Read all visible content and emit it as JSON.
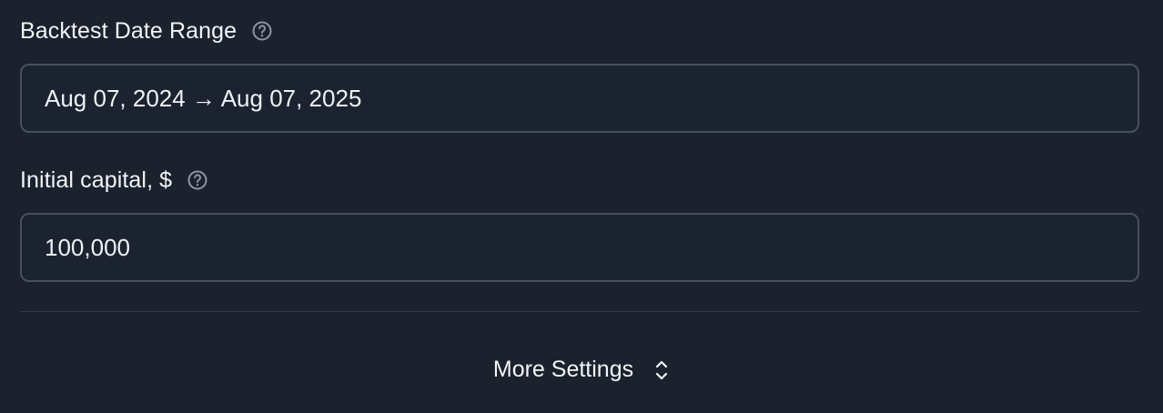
{
  "date_range": {
    "label": "Backtest Date Range",
    "help_icon": "question-circle-icon",
    "value": "Aug 07, 2024 → Aug 07, 2025"
  },
  "initial_capital": {
    "label": "Initial capital, $",
    "help_icon": "question-circle-icon",
    "value": "100,000"
  },
  "more_settings": {
    "label": "More Settings",
    "icon": "chevron-up-down-icon"
  },
  "colors": {
    "background": "#1b222d",
    "field_border": "#465160",
    "text": "#f2f4f7",
    "muted_icon": "#8b95a3"
  }
}
